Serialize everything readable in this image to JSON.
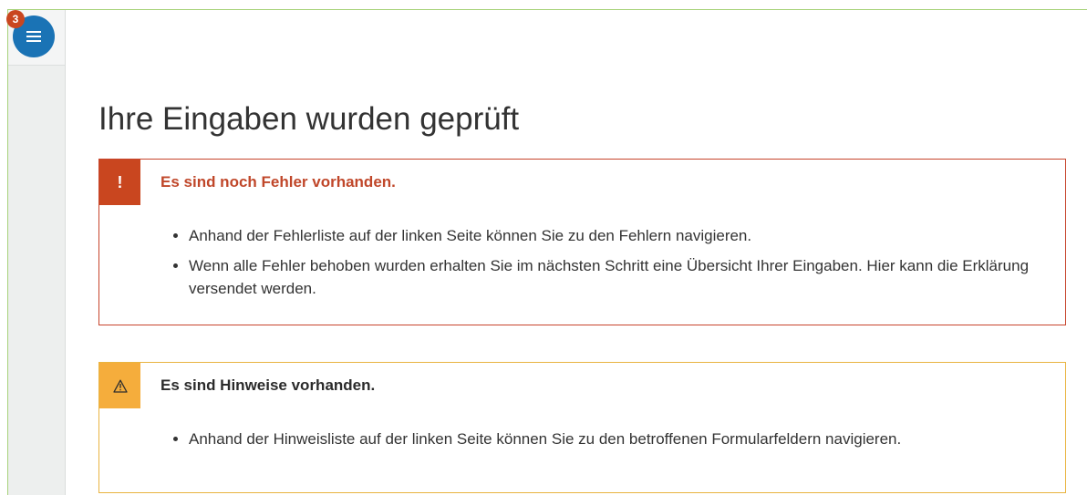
{
  "sidebar": {
    "badge_count": "3",
    "menu_icon": "menu-icon"
  },
  "page": {
    "title": "Ihre Eingaben wurden geprüft"
  },
  "error_notice": {
    "icon": "!",
    "title": "Es sind noch Fehler vorhanden.",
    "items": [
      "Anhand der Fehlerliste auf der linken Seite können Sie zu den Fehlern navigieren.",
      "Wenn alle Fehler behoben wurden erhalten Sie im nächsten Schritt eine Übersicht Ihrer Eingaben. Hier kann die Erklärung versendet werden."
    ]
  },
  "warning_notice": {
    "icon": "warning-icon",
    "title": "Es sind Hinweise vorhanden.",
    "items": [
      "Anhand der Hinweisliste auf der linken Seite können Sie zu den betroffenen Formularfeldern navigieren."
    ]
  },
  "colors": {
    "accent_blue": "#1a73b5",
    "error_red": "#c9461f",
    "warning_orange": "#f5ad3c",
    "frame_green": "#a7d27a"
  }
}
